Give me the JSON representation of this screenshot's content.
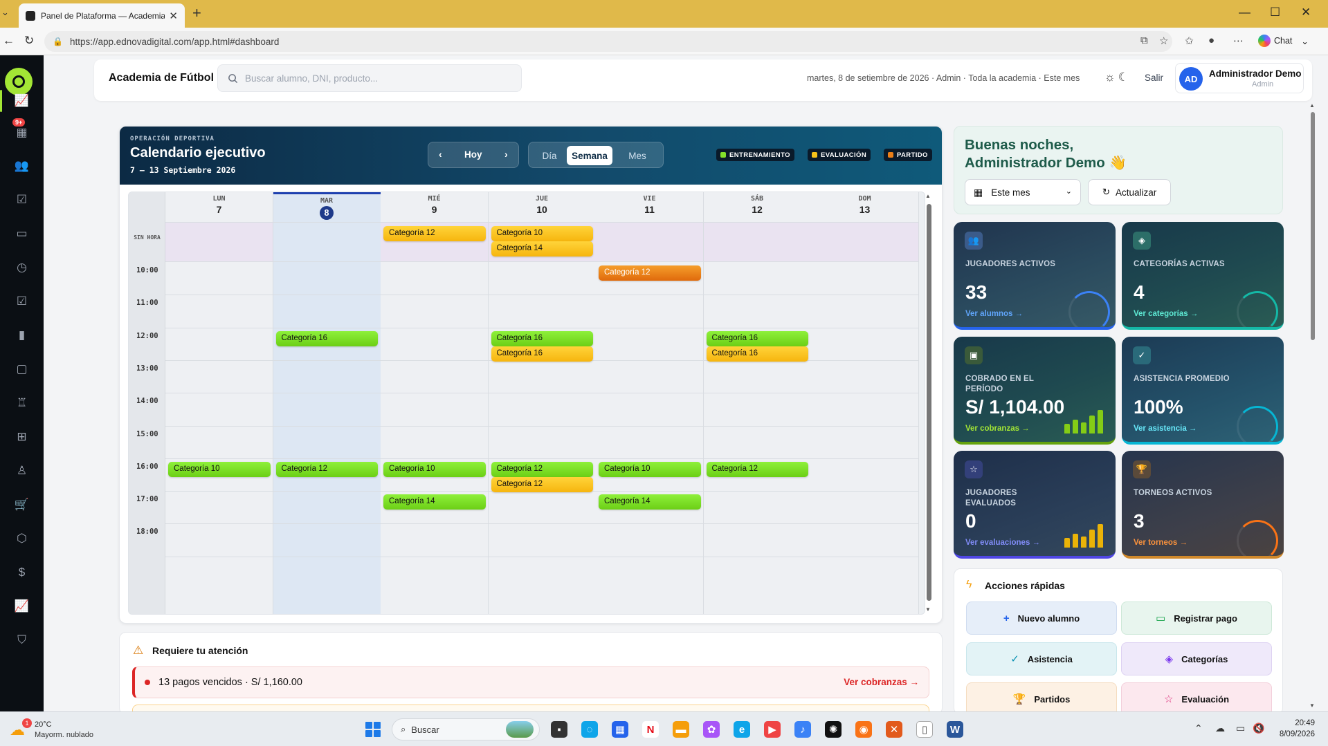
{
  "browser": {
    "tab_title": "Panel de Plataforma — Academia d",
    "url": "https://app.ednovadigital.com/app.html#dashboard",
    "chat_label": "Chat"
  },
  "sidebar": {
    "badge": "9+",
    "items": [
      {
        "name": "dashboard",
        "glyph": "📈"
      },
      {
        "name": "notifications",
        "glyph": "▦"
      },
      {
        "name": "students",
        "glyph": "👥"
      },
      {
        "name": "attendance",
        "glyph": "☑"
      },
      {
        "name": "books",
        "glyph": "▭"
      },
      {
        "name": "history",
        "glyph": "◷"
      },
      {
        "name": "tasks",
        "glyph": "☑"
      },
      {
        "name": "stats",
        "glyph": "▮"
      },
      {
        "name": "messages",
        "glyph": "▢"
      },
      {
        "name": "trophy",
        "glyph": "♖"
      },
      {
        "name": "add",
        "glyph": "⊞"
      },
      {
        "name": "coach",
        "glyph": "♙"
      },
      {
        "name": "shop",
        "glyph": "🛒"
      },
      {
        "name": "products",
        "glyph": "⬡"
      },
      {
        "name": "payments",
        "glyph": "$"
      },
      {
        "name": "reports",
        "glyph": "📈"
      },
      {
        "name": "security",
        "glyph": "⛉"
      }
    ]
  },
  "header": {
    "title": "Academia de Fútbol",
    "search_placeholder": "Buscar alumno, DNI, producto...",
    "info": "martes, 8 de setiembre de 2026 · Admin · Toda la academia · Este mes",
    "logout": "Salir",
    "avatar_initials": "AD",
    "user_name": "Administrador Demo",
    "user_role": "Admin"
  },
  "calendar": {
    "eyebrow": "OPERACIÓN DEPORTIVA",
    "title": "Calendario ejecutivo",
    "range": "7 – 13 Septiembre 2026",
    "prev": "‹",
    "today_label": "Hoy",
    "next": "›",
    "views": [
      "Día",
      "Semana",
      "Mes"
    ],
    "active_view": "Semana",
    "legend": [
      {
        "label": "ENTRENAMIENTO",
        "color": "#84e12a"
      },
      {
        "label": "EVALUACIÓN",
        "color": "#f7c31a"
      },
      {
        "label": "PARTIDO",
        "color": "#ec7f18"
      }
    ],
    "allday_label": "SIN HORA",
    "days": [
      {
        "dow": "LUN",
        "num": "7"
      },
      {
        "dow": "MAR",
        "num": "8"
      },
      {
        "dow": "MIÉ",
        "num": "9"
      },
      {
        "dow": "JUE",
        "num": "10"
      },
      {
        "dow": "VIE",
        "num": "11"
      },
      {
        "dow": "SÁB",
        "num": "12"
      },
      {
        "dow": "DOM",
        "num": "13"
      }
    ],
    "today_index": 1,
    "hours": [
      "10:00",
      "11:00",
      "12:00",
      "13:00",
      "14:00",
      "15:00",
      "16:00",
      "17:00",
      "18:00"
    ],
    "events": [
      {
        "day": 2,
        "slot": "allday",
        "row": 0,
        "type": "yellow",
        "label": "Categoría 12"
      },
      {
        "day": 3,
        "slot": "allday",
        "row": 0,
        "type": "yellow",
        "label": "Categoría 10"
      },
      {
        "day": 3,
        "slot": "allday",
        "row": 1,
        "type": "yellow",
        "label": "Categoría 14"
      },
      {
        "day": 4,
        "slot": "10:00",
        "row": 0,
        "type": "orange",
        "label": "Categoría 12"
      },
      {
        "day": 1,
        "slot": "12:00",
        "row": 0,
        "type": "green",
        "label": "Categoría 16"
      },
      {
        "day": 3,
        "slot": "12:00",
        "row": 0,
        "type": "green",
        "label": "Categoría 16"
      },
      {
        "day": 3,
        "slot": "12:00",
        "row": 1,
        "type": "yellow",
        "label": "Categoría 16"
      },
      {
        "day": 5,
        "slot": "12:00",
        "row": 0,
        "type": "green",
        "label": "Categoría 16"
      },
      {
        "day": 5,
        "slot": "12:00",
        "row": 1,
        "type": "yellow",
        "label": "Categoría 16"
      },
      {
        "day": 0,
        "slot": "16:00",
        "row": 0,
        "type": "green",
        "label": "Categoría 10"
      },
      {
        "day": 1,
        "slot": "16:00",
        "row": 0,
        "type": "green",
        "label": "Categoría 12"
      },
      {
        "day": 2,
        "slot": "16:00",
        "row": 0,
        "type": "green",
        "label": "Categoría 10"
      },
      {
        "day": 3,
        "slot": "16:00",
        "row": 0,
        "type": "green",
        "label": "Categoría 12"
      },
      {
        "day": 3,
        "slot": "16:00",
        "row": 1,
        "type": "yellow",
        "label": "Categoría 12"
      },
      {
        "day": 4,
        "slot": "16:00",
        "row": 0,
        "type": "green",
        "label": "Categoría 10"
      },
      {
        "day": 5,
        "slot": "16:00",
        "row": 0,
        "type": "green",
        "label": "Categoría 12"
      },
      {
        "day": 2,
        "slot": "17:00",
        "row": 0,
        "type": "green",
        "label": "Categoría 14"
      },
      {
        "day": 4,
        "slot": "17:00",
        "row": 0,
        "type": "green",
        "label": "Categoría 14"
      }
    ]
  },
  "attention": {
    "title": "Requiere tu atención",
    "alert_text": "13 pagos vencidos · S/ 1,160.00",
    "alert_link": "Ver cobranzas →"
  },
  "greeting": {
    "line1": "Buenas noches,",
    "line2": "Administrador Demo 👋",
    "period": "Este mes",
    "refresh": "Actualizar"
  },
  "stats": [
    {
      "label": "JUGADORES ACTIVOS",
      "value": "33",
      "link": "Ver alumnos →",
      "icon": "👥",
      "icon_bg": "#3b5b8a",
      "link_color": "#60a5fa",
      "deco": "ring",
      "ring": "c1"
    },
    {
      "label": "CATEGORÍAS ACTIVAS",
      "value": "4",
      "link": "Ver categorías →",
      "icon": "◈",
      "icon_bg": "#2c6e68",
      "link_color": "#5eead4",
      "deco": "ring",
      "ring": "c2"
    },
    {
      "label": "COBRADO EN EL PERÍODO",
      "value": "S/ 1,104.00",
      "link": "Ver cobranzas →",
      "icon": "▣",
      "icon_bg": "#3a5a3a",
      "link_color": "#a3e635",
      "deco": "bars",
      "bar_color": "#84cc16"
    },
    {
      "label": "ASISTENCIA PROMEDIO",
      "value": "100%",
      "link": "Ver asistencia →",
      "icon": "✓",
      "icon_bg": "#2a6a7a",
      "link_color": "#67e8f9",
      "deco": "ring",
      "ring": "c3"
    },
    {
      "label": "JUGADORES EVALUADOS",
      "value": "0",
      "link": "Ver evaluaciones →",
      "icon": "☆",
      "icon_bg": "#33407a",
      "link_color": "#818cf8",
      "deco": "bars",
      "bar_color": "#eab308"
    },
    {
      "label": "TORNEOS ACTIVOS",
      "value": "3",
      "link": "Ver torneos →",
      "icon": "🏆",
      "icon_bg": "#5a4a3a",
      "link_color": "#fb923c",
      "deco": "ring",
      "ring": "c4"
    }
  ],
  "quick": {
    "title": "Acciones rápidas",
    "buttons": [
      {
        "label": "Nuevo alumno",
        "glyph": "+",
        "bg": "#e6eef9",
        "border": "#cfdcf0",
        "gc": "#2563eb"
      },
      {
        "label": "Registrar pago",
        "glyph": "▭",
        "bg": "#e8f5ee",
        "border": "#cde8d8",
        "gc": "#16a34a"
      },
      {
        "label": "Asistencia",
        "glyph": "✓",
        "bg": "#e3f3f6",
        "border": "#c9e6ec",
        "gc": "#0891b2"
      },
      {
        "label": "Categorías",
        "glyph": "◈",
        "bg": "#efe9fa",
        "border": "#ddd2f2",
        "gc": "#7c3aed"
      },
      {
        "label": "Partidos",
        "glyph": "🏆",
        "bg": "#fdf1e4",
        "border": "#f5dcc0",
        "gc": "#ea580c"
      },
      {
        "label": "Evaluación",
        "glyph": "☆",
        "bg": "#fce8ee",
        "border": "#f3cfdb",
        "gc": "#db2777"
      }
    ]
  },
  "taskbar": {
    "weather_badge": "1",
    "temp": "20°C",
    "weather_desc": "Mayorm. nublado",
    "search": "Buscar",
    "time": "20:49",
    "date": "8/09/2026"
  }
}
